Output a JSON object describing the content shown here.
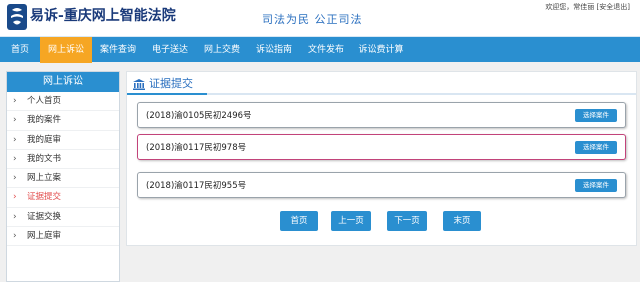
{
  "header": {
    "site_title": "易诉-重庆网上智能法院",
    "slogan": "司法为民   公正司法",
    "welcome_text": "欢迎您，常佳丽 [安全退出]"
  },
  "nav": {
    "items": [
      {
        "label": "首页"
      },
      {
        "label": "网上诉讼",
        "active": true
      },
      {
        "label": "案件查询"
      },
      {
        "label": "电子送达"
      },
      {
        "label": "网上交费"
      },
      {
        "label": "诉讼指南"
      },
      {
        "label": "文件发布"
      },
      {
        "label": "诉讼费计算"
      }
    ]
  },
  "sidebar": {
    "title": "网上诉讼",
    "items": [
      {
        "label": "个人首页"
      },
      {
        "label": "我的案件"
      },
      {
        "label": "我的庭审"
      },
      {
        "label": "我的文书"
      },
      {
        "label": "网上立案"
      },
      {
        "label": "证据提交",
        "active": true
      },
      {
        "label": "证据交换"
      },
      {
        "label": "网上庭审"
      }
    ]
  },
  "main": {
    "title": "证据提交",
    "cases": [
      {
        "number": "(2018)渝0105民初2496号",
        "button": "选择案件"
      },
      {
        "number": "(2018)渝0117民初978号",
        "button": "选择案件",
        "highlighted": true
      },
      {
        "number": "(2018)渝0117民初955号",
        "button": "选择案件"
      }
    ]
  },
  "pagination": {
    "first": "首页",
    "prev": "上一页",
    "next": "下一页",
    "last": "末页"
  },
  "colors": {
    "primary": "#2a8fd0",
    "active_tab": "#f6a623",
    "highlight_border": "#c2437a",
    "active_side": "#e24c4c"
  }
}
